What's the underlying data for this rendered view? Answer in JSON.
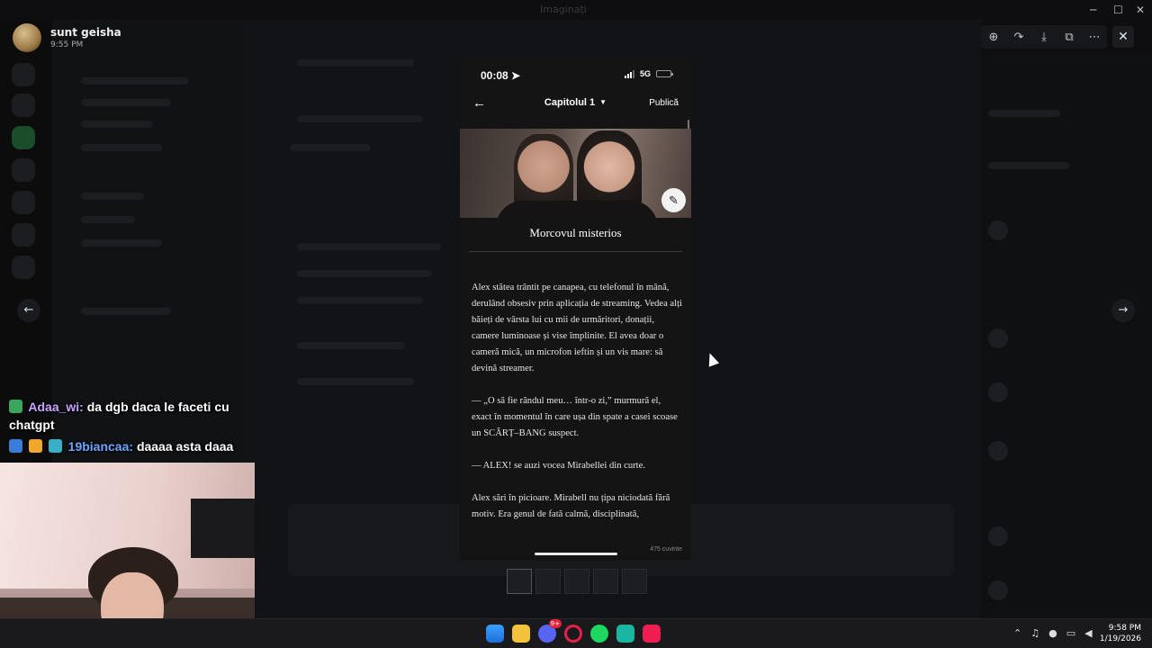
{
  "window": {
    "title": "Imaginați"
  },
  "viewer": {
    "user_name": "sunt geisha",
    "time": "9:55 PM"
  },
  "toolbar": {
    "icons": [
      "zoom-icon",
      "share-icon",
      "download-icon",
      "open-external-icon",
      "more-icon"
    ],
    "close_symbol": "✕",
    "prev_symbol": "←",
    "next_symbol": "→"
  },
  "stream_chat": [
    {
      "user": "Adaa_wi:",
      "message": "da dgb daca le faceti cu chatgpt",
      "badge_colors": [
        "#3ba55d"
      ]
    },
    {
      "user": "19biancaa:",
      "message": "daaaa asta daaa",
      "badge_colors": [
        "#3b7bd9",
        "#f0a82c",
        "#3ab0c8"
      ]
    }
  ],
  "phone": {
    "status": {
      "time": "00:08",
      "network": "5G"
    },
    "header": {
      "back": "←",
      "chapter": "Capitolul 1",
      "publish": "Publică"
    },
    "story_title": "Morcovul misterios",
    "paragraphs": [
      "Alex stătea trântit pe canapea, cu telefonul în mână, derulând obsesiv prin aplicația de streaming. Vedea alți băieți de vârsta lui cu mii de urmăritori, donații, camere luminoase și vise împlinite. El avea doar o cameră mică, un microfon ieftin și un vis mare: să devină streamer.",
      "— „O să fie rândul meu… într-o zi,” murmură el, exact în momentul în care ușa din spate a casei scoase un SCÂRȚ–BANG suspect.",
      "— ALEX! se auzi vocea Mirabellei din curte.",
      "Alex sări în picioare. Mirabell nu țipa niciodată fără motiv. Era genul de fată calmă, disciplinată,"
    ],
    "word_count": "475 cuvinte"
  },
  "taskbar": {
    "apps": [
      {
        "name": "windows-start-icon",
        "color": "#3aa0ff"
      },
      {
        "name": "file-explorer-icon",
        "color": "#f5c33b"
      },
      {
        "name": "discord-icon",
        "color": "#5865f2"
      },
      {
        "name": "opera-gx-icon",
        "color": "#e0224a"
      },
      {
        "name": "spotify-icon",
        "color": "#1ed760"
      },
      {
        "name": "app-store-icon",
        "color": "#1ab5a3"
      },
      {
        "name": "tiktok-icon",
        "color": "#ee1d52"
      }
    ],
    "notification_badge": "9+",
    "clock_time": "9:58 PM",
    "clock_date": "1/19/2026"
  }
}
